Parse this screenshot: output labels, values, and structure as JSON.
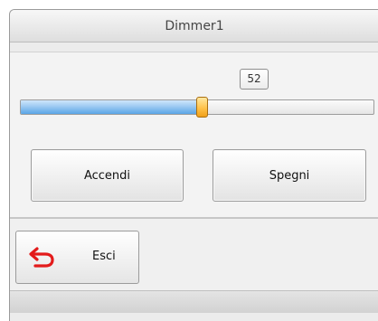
{
  "window": {
    "title": "Dimmer1"
  },
  "dimmer": {
    "value": 52,
    "value_label": "52",
    "level_fraction": 0.52
  },
  "buttons": {
    "on_label": "Accendi",
    "off_label": "Spegni",
    "exit_label": "Esci",
    "exit_icon": "undo-arrow-icon"
  },
  "colors": {
    "slider_fill": "#7db8ec",
    "slider_thumb": "#ffb830",
    "exit_icon": "#e31b1b"
  }
}
